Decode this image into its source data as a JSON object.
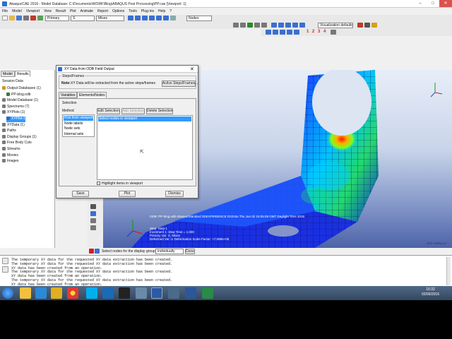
{
  "window": {
    "title": "Abaqus/CAE 2016 - Model Database: C:\\Documents\\WORK\\Blog\\ABAQUS Post Processing\\PP.cae [Viewport: 1]"
  },
  "menubar": [
    "File",
    "Model",
    "Viewport",
    "View",
    "Result",
    "Plot",
    "Animate",
    "Report",
    "Options",
    "Tools",
    "Plug-ins",
    "Help",
    "?"
  ],
  "toolbar": {
    "primary_combo": "Primary",
    "s_combo": "S",
    "mises_combo": "Mises",
    "nodes_combo": "Nodes",
    "visualization_combo": "Visualization defaults",
    "view_numbers": [
      "1",
      "2",
      "3",
      "4"
    ]
  },
  "left_panel": {
    "tabs": [
      "Model",
      "Results"
    ],
    "section": "Session Data",
    "tree": [
      {
        "label": "Output Databases (1)",
        "color": "#c79a26",
        "indent": 0
      },
      {
        "label": "PP-blog.odb",
        "color": "#3a7a3a",
        "indent": 1
      },
      {
        "label": "Model Database (1)",
        "color": "#7a7a7a",
        "indent": 0
      },
      {
        "label": "Spectrums (7)",
        "color": "#7a7a7a",
        "indent": 0
      },
      {
        "label": "XYPlots (1)",
        "color": "#7a7a7a",
        "indent": 0
      },
      {
        "label": "XYPlot-1",
        "color": "#3366cc",
        "indent": 1,
        "selected": true
      },
      {
        "label": "XYData (1)",
        "color": "#7a7a7a",
        "indent": 0
      },
      {
        "label": "Paths",
        "color": "#7a7a7a",
        "indent": 0
      },
      {
        "label": "Display Groups (1)",
        "color": "#7a7a7a",
        "indent": 0
      },
      {
        "label": "Free Body Cuts",
        "color": "#7a7a7a",
        "indent": 0
      },
      {
        "label": "Streams",
        "color": "#7a7a7a",
        "indent": 0
      },
      {
        "label": "Movies",
        "color": "#7a7a7a",
        "indent": 0
      },
      {
        "label": "Images",
        "color": "#7a7a7a",
        "indent": 0
      }
    ]
  },
  "dialog": {
    "title": "XY Data from ODB Field Output",
    "steps_frames_label": "Steps/Frames",
    "note_bold": "Note:",
    "note_text": "XY Data will be extracted from the active steps/frames",
    "active_steps_button": "Active Steps/Frames...",
    "tabs": [
      "Variables",
      "Elements/Nodes"
    ],
    "selection_label": "Selection",
    "method_label": "Method",
    "methods": [
      "Pick from viewport",
      "Node labels",
      "Node sets",
      "Internal sets"
    ],
    "edit_selection": "Edit Selection",
    "add_selection": "Add Selection",
    "delete_selection": "Delete Selection",
    "selection_items": [
      "Select nodes in viewport"
    ],
    "highlight_label": "Highlight items in viewport",
    "save_button": "Save",
    "plot_button": "Plot",
    "dismiss_button": "Dismiss"
  },
  "viewport": {
    "legend_line1": "ODB: PP-blog.odb    Abaqus/Standard 3DEXPERIENCE R2016x    Thu Jun 02 15:05:09 GMT Daylight Time 2016",
    "legend_line2": "Step: Step-1",
    "legend_line3": "Increment    1: Step Time =    1.000",
    "legend_line4": "Primary Var: S, Mises",
    "legend_line5": "Deformed Var: U   Deformation Scale Factor: +7.098e+06",
    "brand": "3DS SIMULIA"
  },
  "prompt": {
    "text": "Select nodes for the display group",
    "combo": "individually",
    "done_button": "Done"
  },
  "messages": [
    "The temporary XY data for the requested XY data extraction has been created.",
    "The temporary XY data for the requested XY data extraction has been created.",
    "XY data has been created from an operation.",
    "The temporary XY data for the requested XY data extraction has been created.",
    "XY data has been created from an operation.",
    "The temporary XY data for the requested XY data extraction has been created.",
    "XY data has been created from an operation."
  ],
  "taskbar": {
    "time": "16:32",
    "date": "02/06/2016"
  }
}
